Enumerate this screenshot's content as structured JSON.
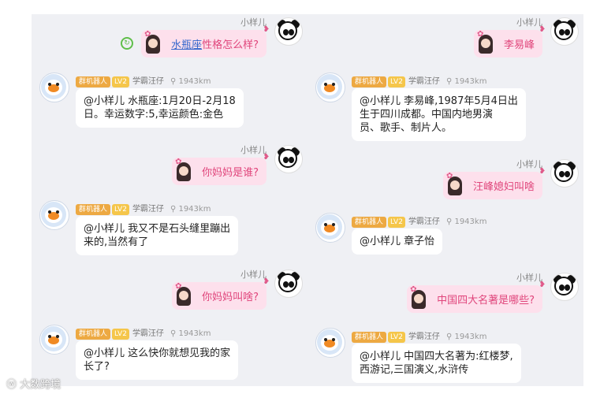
{
  "left": {
    "messages": [
      {
        "user": "小样儿",
        "text_link": "水瓶座",
        "text_rest": "性格怎么样?"
      },
      {
        "bot_tag": "群机器人",
        "bot_level": "LV2",
        "bot_name": "学霸汪仔",
        "bot_distance": "1943km",
        "text": "@小样儿 水瓶座:1月20日-2月18\n日。幸运数字:5,幸运颜色:金色"
      },
      {
        "user": "小样儿",
        "text": "你妈妈是谁?"
      },
      {
        "bot_tag": "群机器人",
        "bot_level": "LV2",
        "bot_name": "学霸汪仔",
        "bot_distance": "1943km",
        "text": "@小样儿 我又不是石头缝里蹦出\n来的,当然有了"
      },
      {
        "user": "小样儿",
        "text": "你妈妈叫啥?"
      },
      {
        "bot_tag": "群机器人",
        "bot_level": "LV2",
        "bot_name": "学霸汪仔",
        "bot_distance": "1943km",
        "text": "@小样儿 这么快你就想见我的家\n长了?"
      }
    ]
  },
  "right": {
    "messages": [
      {
        "user": "小样儿",
        "text": "李易峰"
      },
      {
        "bot_tag": "群机器人",
        "bot_level": "LV2",
        "bot_name": "学霸汪仔",
        "bot_distance": "1943km",
        "text": "@小样儿 李易峰,1987年5月4日出\n生于四川成都。中国内地男演\n员、歌手、制片人。"
      },
      {
        "user": "小样儿",
        "text": "汪峰媳妇叫啥"
      },
      {
        "bot_tag": "群机器人",
        "bot_level": "LV2",
        "bot_name": "学霸汪仔",
        "bot_distance": "1943km",
        "text": "@小样儿 章子怡"
      },
      {
        "user": "小样儿",
        "text": "中国四大名著是哪些?"
      },
      {
        "bot_tag": "群机器人",
        "bot_level": "LV2",
        "bot_name": "学霸汪仔",
        "bot_distance": "1943km",
        "text": "@小样儿 中国四大名著为:红楼梦,\n西游记,三国演义,水浒传"
      }
    ]
  },
  "watermark": "大数跨境",
  "colors": {
    "panel_bg": "#eff0f4",
    "user_bubble": "#fde0ec",
    "user_text": "#e0457b",
    "bot_tag": "#eda942",
    "level_tag": "#f5c64a"
  }
}
